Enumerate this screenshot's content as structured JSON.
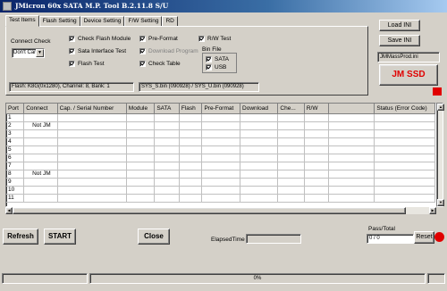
{
  "window": {
    "title": "JMicron 60x SATA M.P. Tool B.2.11.8 S/U"
  },
  "tabs": [
    {
      "label": "Test Items"
    },
    {
      "label": "Flash Setting"
    },
    {
      "label": "Device Setting"
    },
    {
      "label": "F/W Setting"
    },
    {
      "label": "RD"
    }
  ],
  "test_items": {
    "connect_check_label": "Connect Check",
    "connect_check_value": "Don't Care",
    "checks": {
      "check_flash_module": "Check Flash Module",
      "sata_interface_test": "Sata Interface Test",
      "flash_test": "Flash Test",
      "pre_format": "Pre-Format",
      "download_program": "Download Program",
      "check_table": "Check Table",
      "rw_test": "R/W Test"
    },
    "bin_file": {
      "label": "Bin File",
      "sata": "SATA",
      "usb": "USB"
    },
    "flash_info": "Flash: K8G(0x1280), Channel: 8, Bank: 1",
    "sys_info": "SYS_S.bin (090928)  /  SYS_U.bin (090928)"
  },
  "side": {
    "load_ini": "Load INI",
    "save_ini": "Save INI",
    "ini_file": "JMMassProd.ini",
    "brand": "JM SSD",
    "brand_color": "#e00000"
  },
  "table": {
    "columns": [
      "Port",
      "Connect",
      "Cap. / Serial Number",
      "Module",
      "SATA",
      "Flash",
      "Pre-Format",
      "Download",
      "Che...",
      "R/W",
      "",
      "Status (Error Code)"
    ],
    "rows": [
      [
        "1",
        "",
        "",
        "",
        "",
        "",
        "",
        "",
        "",
        "",
        "",
        ""
      ],
      [
        "2",
        "Not JM",
        "",
        "",
        "",
        "",
        "",
        "",
        "",
        "",
        "",
        ""
      ],
      [
        "3",
        "",
        "",
        "",
        "",
        "",
        "",
        "",
        "",
        "",
        "",
        ""
      ],
      [
        "4",
        "",
        "",
        "",
        "",
        "",
        "",
        "",
        "",
        "",
        "",
        ""
      ],
      [
        "5",
        "",
        "",
        "",
        "",
        "",
        "",
        "",
        "",
        "",
        "",
        ""
      ],
      [
        "6",
        "",
        "",
        "",
        "",
        "",
        "",
        "",
        "",
        "",
        "",
        ""
      ],
      [
        "7",
        "",
        "",
        "",
        "",
        "",
        "",
        "",
        "",
        "",
        "",
        ""
      ],
      [
        "8",
        "Not JM",
        "",
        "",
        "",
        "",
        "",
        "",
        "",
        "",
        "",
        ""
      ],
      [
        "9",
        "",
        "",
        "",
        "",
        "",
        "",
        "",
        "",
        "",
        "",
        ""
      ],
      [
        "10",
        "",
        "",
        "",
        "",
        "",
        "",
        "",
        "",
        "",
        "",
        ""
      ],
      [
        "11",
        "",
        "",
        "",
        "",
        "",
        "",
        "",
        "",
        "",
        "",
        ""
      ]
    ]
  },
  "bottom": {
    "refresh": "Refresh",
    "start": "START",
    "close": "Close",
    "elapsed_label": "ElapsedTime",
    "pass_total_label": "Pass/Total",
    "pass_total_value": "0 / 0",
    "reset": "Reset",
    "progress_text": "0%",
    "progress_value": 0
  }
}
